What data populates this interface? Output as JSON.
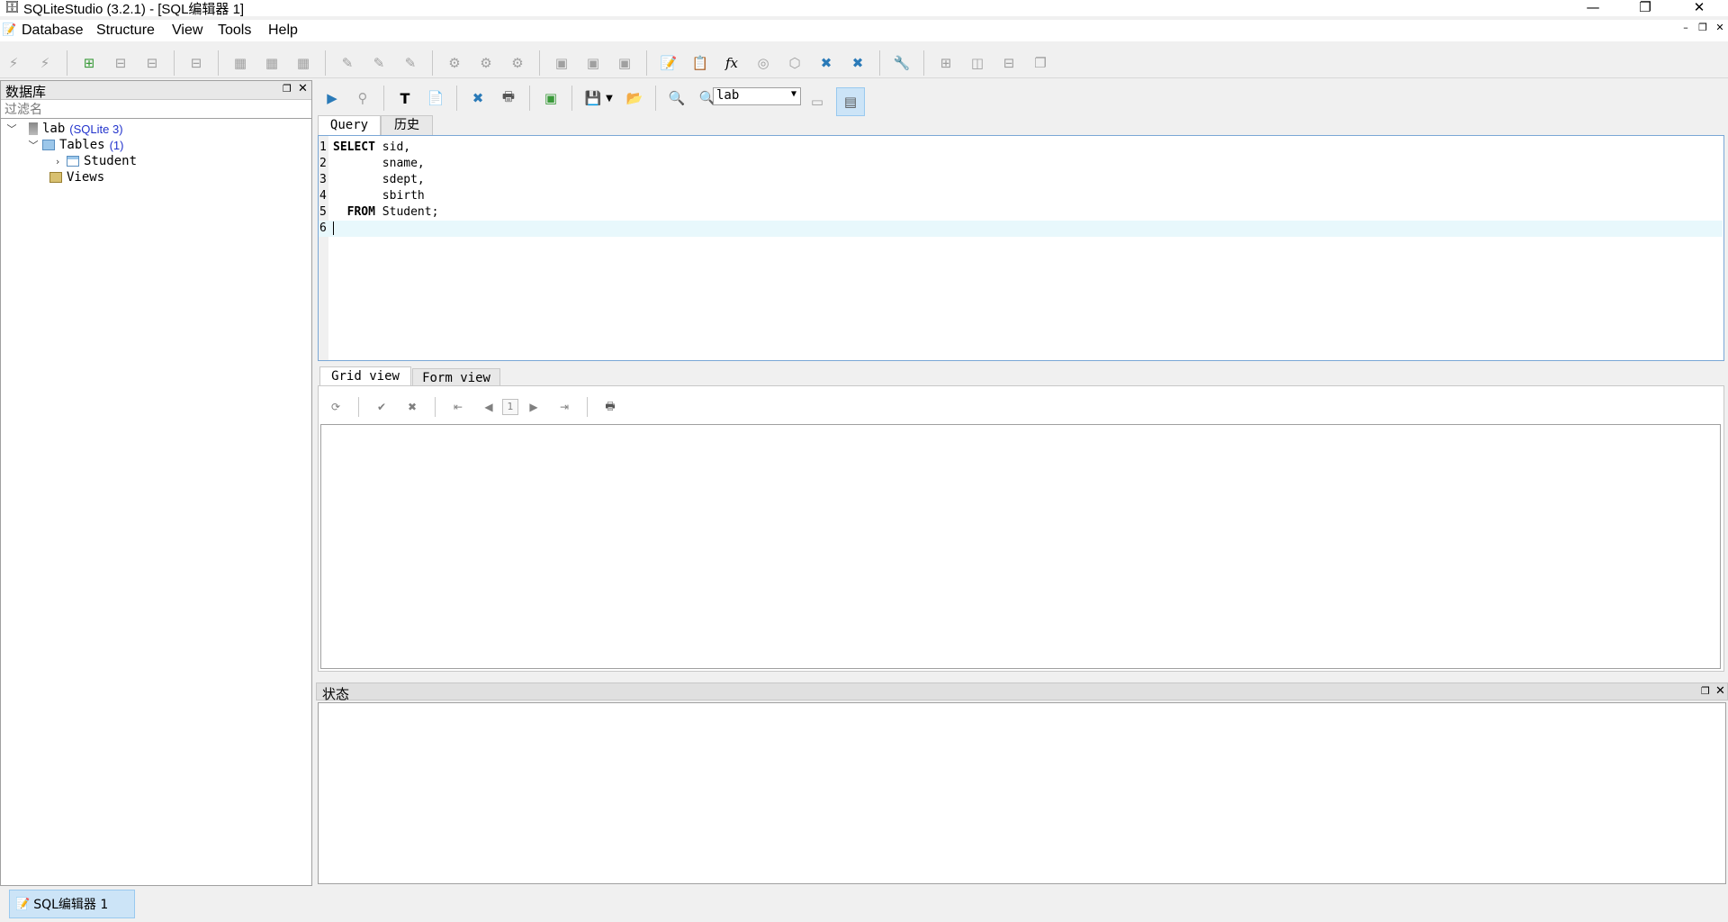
{
  "window": {
    "title": "SQLiteStudio (3.2.1) - [SQL编辑器 1]",
    "minimize": "—",
    "restore": "❐",
    "close": "✕"
  },
  "menu": {
    "items": [
      "Database",
      "Structure",
      "View",
      "Tools",
      "Help"
    ],
    "mdi_minimize": "–",
    "mdi_restore": "❐",
    "mdi_close": "✕"
  },
  "db_panel": {
    "title": "数据库",
    "filter_placeholder": "过滤名",
    "float_icon": "❐",
    "close_icon": "✕",
    "tree": {
      "db_name": "lab",
      "db_type": "(SQLite 3)",
      "tables_label": "Tables",
      "tables_count": "(1)",
      "table_name": "Student",
      "views_label": "Views"
    }
  },
  "editor": {
    "db_select_value": "lab",
    "tabs": [
      "Query",
      "历史"
    ],
    "lines": [
      {
        "n": "1",
        "kw": "SELECT",
        "rest": " sid,"
      },
      {
        "n": "2",
        "kw": "",
        "rest": "       sname,"
      },
      {
        "n": "3",
        "kw": "",
        "rest": "       sdept,"
      },
      {
        "n": "4",
        "kw": "",
        "rest": "       sbirth"
      },
      {
        "n": "5",
        "kw": "  FROM",
        "rest": " Student;"
      },
      {
        "n": "6",
        "kw": "",
        "rest": ""
      }
    ]
  },
  "results": {
    "tabs": [
      "Grid view",
      "Form view"
    ],
    "page_number": "1"
  },
  "status_panel": {
    "title": "状态"
  },
  "taskbar": {
    "window_tab": "SQL编辑器  1"
  },
  "colors": {
    "accent": "#7aa7d6",
    "current_line": "#e8f8fc",
    "tree_sublabel": "#2233cc"
  }
}
